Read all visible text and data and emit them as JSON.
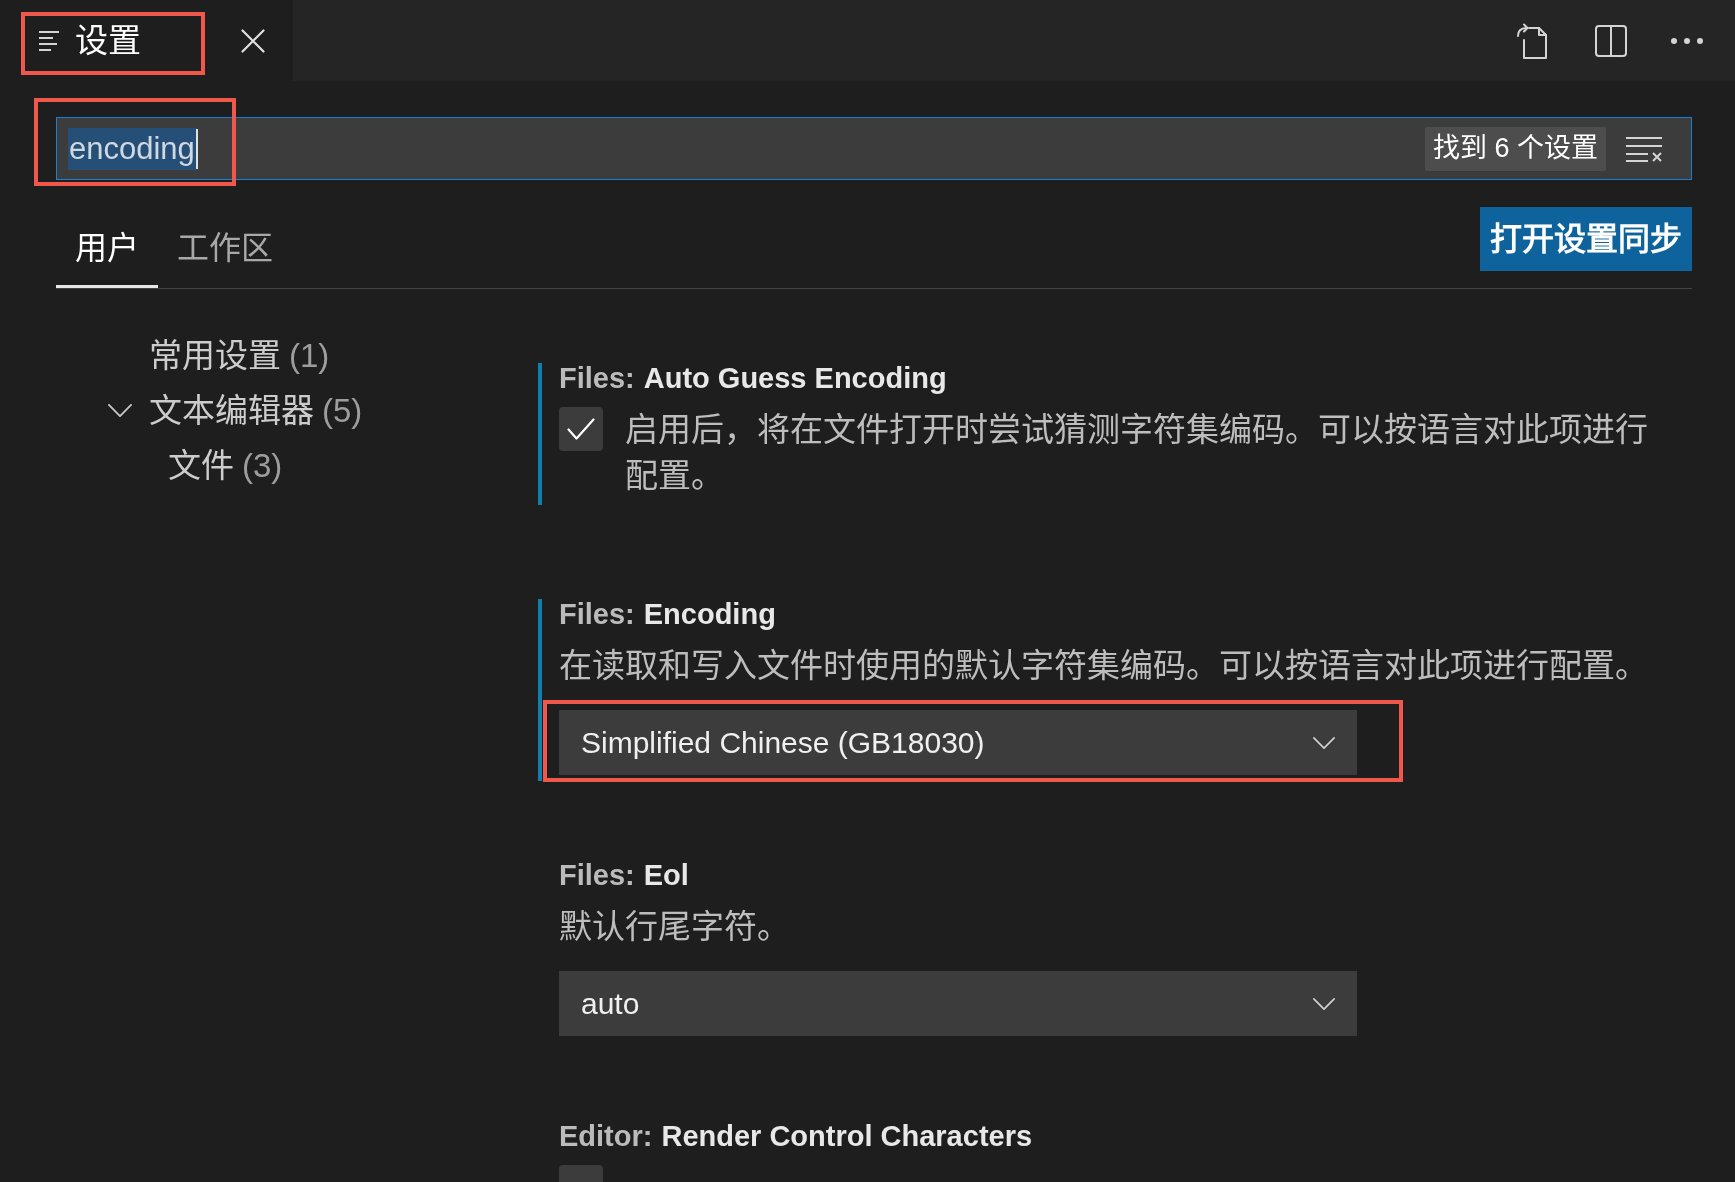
{
  "editor_tab": {
    "title": "设置",
    "highlighted": true
  },
  "search": {
    "value": "encoding",
    "value_selected": true,
    "highlighted": true,
    "result_count": "找到 6 个设置"
  },
  "scope_tabs": [
    {
      "label": "用户",
      "selected": true
    },
    {
      "label": "工作区",
      "selected": false
    }
  ],
  "sync_button": "打开设置同步",
  "toc": [
    {
      "label": "常用设置",
      "count": "(1)"
    },
    {
      "label": "文本编辑器",
      "count": "(5)",
      "expanded": true,
      "children": [
        {
          "label": "文件",
          "count": "(3)"
        }
      ]
    }
  ],
  "settings": [
    {
      "kind": "checkbox",
      "category": "Files:",
      "name": "Auto Guess Encoding",
      "description": "启用后，将在文件打开时尝试猜测字符集编码。可以按语言对此项进行配置。",
      "checked": true,
      "modified": true
    },
    {
      "kind": "dropdown",
      "category": "Files:",
      "name": "Encoding",
      "description": "在读取和写入文件时使用的默认字符集编码。可以按语言对此项进行配置。",
      "value": "Simplified Chinese (GB18030)",
      "modified": true,
      "highlighted": true
    },
    {
      "kind": "dropdown",
      "category": "Files:",
      "name": "Eol",
      "description": "默认行尾字符。",
      "value": "auto",
      "modified": false
    },
    {
      "kind": "checkbox",
      "category": "Editor:",
      "name": "Render Control Characters",
      "checked": false,
      "modified": false
    }
  ]
}
